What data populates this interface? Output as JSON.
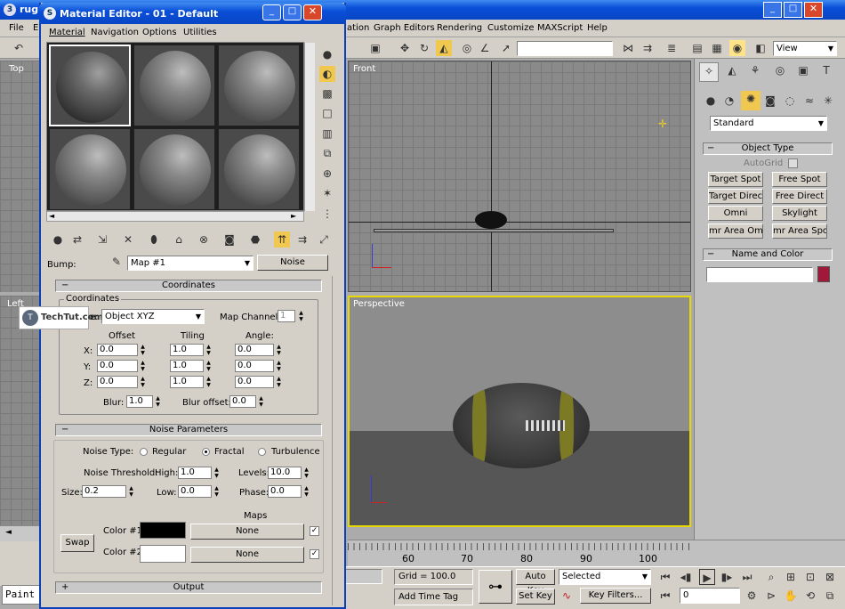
{
  "main_window": {
    "title": "rug",
    "menus": [
      "File",
      "E",
      "ation",
      "Graph Editors",
      "Rendering",
      "Customize",
      "MAXScript",
      "Help"
    ],
    "view_dropdown": "View",
    "viewports": {
      "top": "Top",
      "left": "Left",
      "front": "Front",
      "perspective": "Perspective"
    },
    "command_panel": {
      "category_dropdown": "Standard",
      "object_type_title": "Object Type",
      "autogrid_label": "AutoGrid",
      "buttons": [
        "Target Spot",
        "Free Spot",
        "Target Direct",
        "Free Direct",
        "Omni",
        "Skylight",
        "mr Area Omni",
        "mr Area Spot"
      ],
      "name_color_title": "Name and Color",
      "object_color": "#a0183a"
    },
    "timeline_ticks": [
      "60",
      "60",
      "70",
      "80",
      "90",
      "100"
    ],
    "status": {
      "grid": "Grid = 100.0",
      "add_time_tag": "Add Time Tag",
      "auto_key": "Auto Key",
      "set_key": "Set Key",
      "selected": "Selected",
      "key_filters": "Key Filters...",
      "frame": "0"
    },
    "maxscript_listener": "Paint"
  },
  "material_editor": {
    "title": "Material Editor - 01 - Default",
    "menus": [
      "Material",
      "Navigation",
      "Options",
      "Utilities"
    ],
    "bump_label": "Bump:",
    "map_name": "Map #1",
    "map_type": "Noise",
    "watermark": "TechTut.com",
    "coordinates": {
      "title": "Coordinates",
      "group": "Coordinates",
      "source_label": "e:",
      "source": "Object XYZ",
      "map_channel_label": "Map Channel:",
      "map_channel": "1",
      "col_headers": [
        "Offset",
        "Tiling",
        "Angle:"
      ],
      "rows": [
        {
          "axis": "X:",
          "offset": "0.0",
          "tiling": "1.0",
          "angle": "0.0"
        },
        {
          "axis": "Y:",
          "offset": "0.0",
          "tiling": "1.0",
          "angle": "0.0"
        },
        {
          "axis": "Z:",
          "offset": "0.0",
          "tiling": "1.0",
          "angle": "0.0"
        }
      ],
      "blur_label": "Blur:",
      "blur": "1.0",
      "blur_offset_label": "Blur offset:",
      "blur_offset": "0.0"
    },
    "noise": {
      "title": "Noise Parameters",
      "type_label": "Noise Type:",
      "types": [
        "Regular",
        "Fractal",
        "Turbulence"
      ],
      "selected_type": "Fractal",
      "threshold_label": "Noise Threshold:",
      "high_label": "High:",
      "high": "1.0",
      "levels_label": "Levels:",
      "levels": "10.0",
      "size_label": "Size:",
      "size": "0.2",
      "low_label": "Low:",
      "low": "0.0",
      "phase_label": "Phase:",
      "phase": "0.0",
      "maps_label": "Maps",
      "swap": "Swap",
      "color1_label": "Color #1",
      "color1": "#000000",
      "color2_label": "Color #2",
      "color2": "#ffffff",
      "map1": "None",
      "map2": "None"
    },
    "output_title": "Output"
  }
}
